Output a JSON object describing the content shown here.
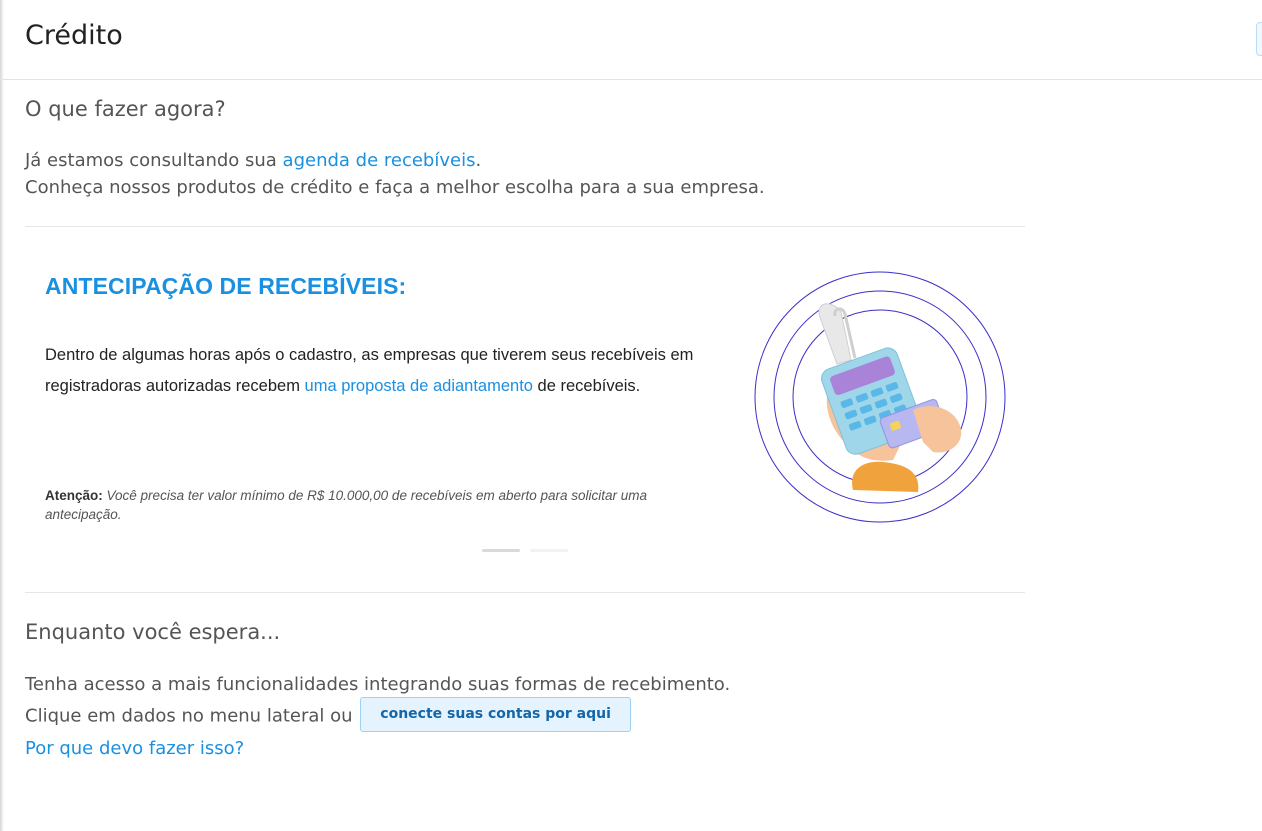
{
  "header": {
    "title": "Crédito"
  },
  "intro": {
    "heading": "O que fazer agora?",
    "line1_text": "Já estamos consultando sua ",
    "line1_link": "agenda de recebíveis",
    "line1_end": ".",
    "line2": "Conheça nossos produtos de crédito e faça a melhor escolha para a sua empresa."
  },
  "card": {
    "title": "ANTECIPAÇÃO DE RECEBÍVEIS:",
    "text_before": "Dentro de algumas horas após o cadastro, as empresas que tiverem seus recebíveis em registradoras autorizadas recebem ",
    "text_link": "uma proposta de adiantamento",
    "text_after": " de recebíveis.",
    "note_label": "Atenção:",
    "note_text": "Você precisa ter valor mínimo de R$ 10.000,00 de recebíveis em aberto para solicitar uma antecipação.",
    "illustration_icon": "card-payment-terminal-icon",
    "carousel": {
      "slides": 2,
      "active": 1
    }
  },
  "wait": {
    "heading": "Enquanto você espera...",
    "line1": "Tenha acesso a mais funcionalidades integrando suas formas de recebimento.",
    "line2_text": "Clique em dados no menu lateral ou",
    "button_label": "conecte suas contas por aqui",
    "why_link": "Por que devo fazer isso?"
  },
  "colors": {
    "accent": "#1a90e0",
    "circles": "#3b2fc9"
  }
}
